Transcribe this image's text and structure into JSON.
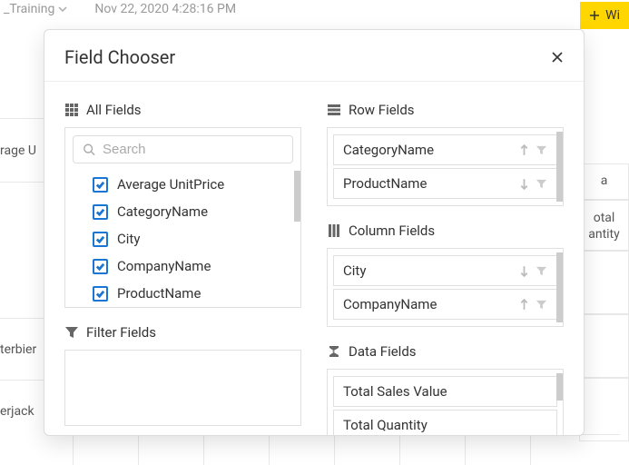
{
  "header": {
    "training_label": "_Training",
    "timestamp": "Nov 22, 2020 4:28:16 PM",
    "widget_button": "Wi"
  },
  "bg": {
    "left1": "rage U",
    "left2": "terbier",
    "left3": "erjack",
    "rightHead1": "a",
    "rightHead2a": "otal",
    "rightHead2b": "antity"
  },
  "modal": {
    "title": "Field Chooser",
    "allFields": {
      "title": "All Fields",
      "searchPlaceholder": "Search",
      "items": [
        "Average UnitPrice",
        "CategoryName",
        "City",
        "CompanyName",
        "ProductName"
      ]
    },
    "filterFields": {
      "title": "Filter Fields"
    },
    "rowFields": {
      "title": "Row Fields",
      "items": [
        {
          "label": "CategoryName",
          "sort": "asc",
          "filtered": false
        },
        {
          "label": "ProductName",
          "sort": "desc",
          "filtered": false
        }
      ]
    },
    "columnFields": {
      "title": "Column Fields",
      "items": [
        {
          "label": "City",
          "sort": "desc",
          "filtered": false
        },
        {
          "label": "CompanyName",
          "sort": "asc",
          "filtered": false
        }
      ]
    },
    "dataFields": {
      "title": "Data Fields",
      "items": [
        {
          "label": "Total Sales Value"
        },
        {
          "label": "Total Quantity"
        }
      ]
    }
  }
}
